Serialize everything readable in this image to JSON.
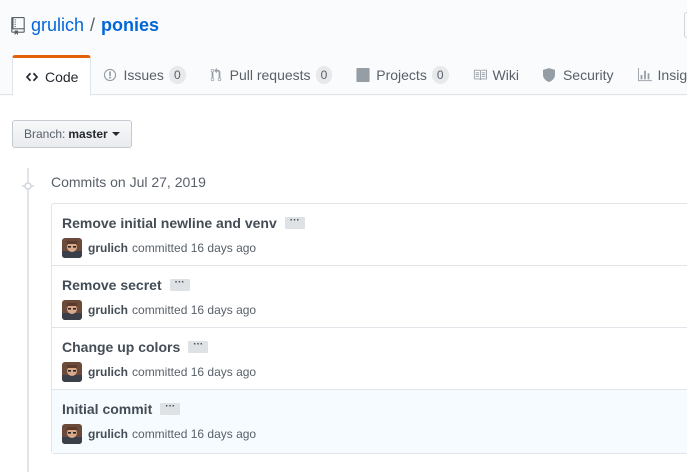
{
  "repo": {
    "owner": "grulich",
    "separator": "/",
    "name": "ponies"
  },
  "tabs": [
    {
      "label": "Code",
      "icon": "code-icon",
      "selected": true
    },
    {
      "label": "Issues",
      "icon": "issue-icon",
      "count": "0"
    },
    {
      "label": "Pull requests",
      "icon": "pull-request-icon",
      "count": "0"
    },
    {
      "label": "Projects",
      "icon": "project-icon",
      "count": "0"
    },
    {
      "label": "Wiki",
      "icon": "book-icon"
    },
    {
      "label": "Security",
      "icon": "shield-icon"
    },
    {
      "label": "Insights",
      "icon": "graph-icon"
    }
  ],
  "branch": {
    "label": "Branch:",
    "name": "master"
  },
  "commits_date": "Commits on Jul 27, 2019",
  "commits": [
    {
      "message": "Remove initial newline and venv",
      "author": "grulich",
      "action": "committed",
      "time": "16 days ago"
    },
    {
      "message": "Remove secret",
      "author": "grulich",
      "action": "committed",
      "time": "16 days ago"
    },
    {
      "message": "Change up colors",
      "author": "grulich",
      "action": "committed",
      "time": "16 days ago"
    },
    {
      "message": "Initial commit",
      "author": "grulich",
      "action": "committed",
      "time": "16 days ago"
    }
  ],
  "ellipsis": "···",
  "colors": {
    "link": "#0366d6",
    "tab_accent": "#e36209",
    "highlight_row": "#f6fbff"
  }
}
